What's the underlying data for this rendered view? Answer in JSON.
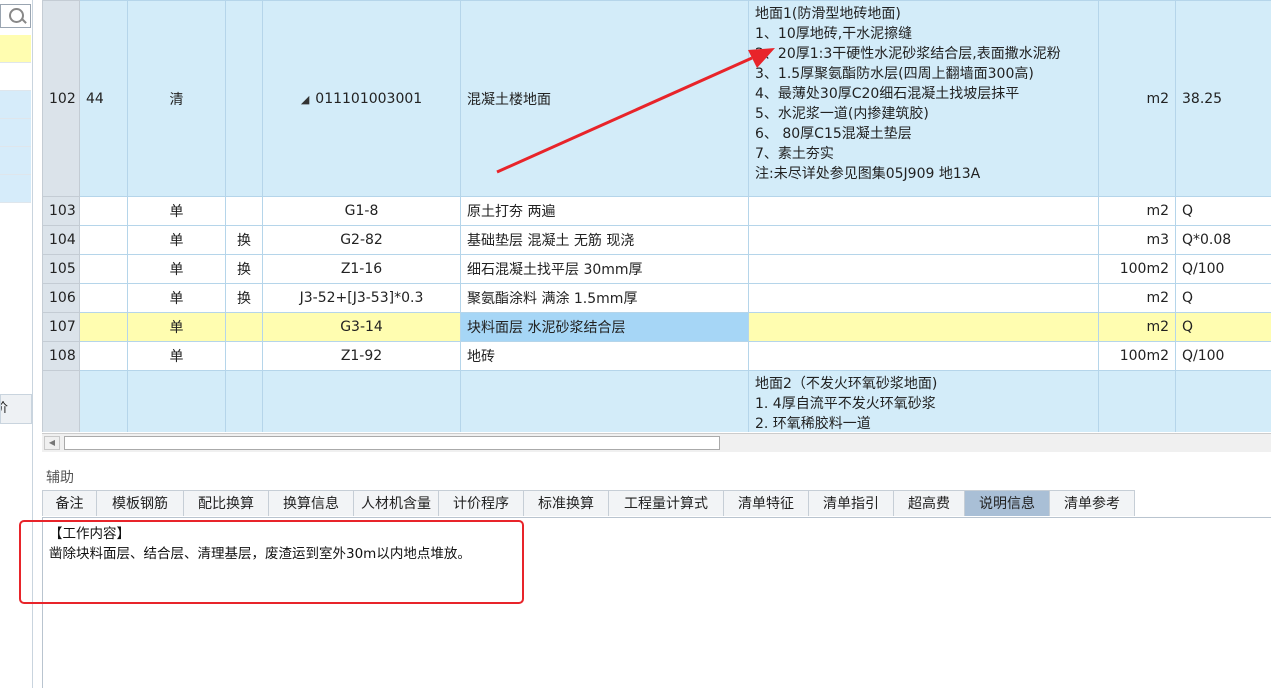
{
  "aux_panel": {
    "title": "辅助"
  },
  "left_panel": {
    "tab_fragment": "价"
  },
  "grid_rows": [
    {
      "no": "102",
      "seq": "44",
      "cat": "清",
      "flag": "",
      "code": "011101003001",
      "name": "混凝土楼地面",
      "feature_lines": [
        "地面1(防滑型地砖地面)",
        "1、10厚地砖,干水泥擦缝",
        "2、20厚1:3干硬性水泥砂浆结合层,表面撒水泥粉",
        "3、1.5厚聚氨酯防水层(四周上翻墙面300高)",
        "4、最薄处30厚C20细石混凝土找坡层抹平",
        "5、水泥浆一道(内掺建筑胶)",
        "6、 80厚C15混凝土垫层",
        "7、素土夯实",
        "注:未尽详处参见图集05J909 地13A"
      ],
      "unit": "m2",
      "qty": "38.25"
    },
    {
      "no": "103",
      "seq": "",
      "cat": "单",
      "flag": "",
      "code": "G1-8",
      "name": "原土打夯 两遍",
      "unit": "m2",
      "qty": "Q"
    },
    {
      "no": "104",
      "seq": "",
      "cat": "单",
      "flag": "换",
      "code": "G2-82",
      "name": "基础垫层 混凝土 无筋 现浇",
      "unit": "m3",
      "qty": "Q*0.08"
    },
    {
      "no": "105",
      "seq": "",
      "cat": "单",
      "flag": "换",
      "code": "Z1-16",
      "name": "细石混凝土找平层 30mm厚",
      "unit": "100m2",
      "qty": "Q/100"
    },
    {
      "no": "106",
      "seq": "",
      "cat": "单",
      "flag": "换",
      "code": "J3-52+[J3-53]*0.3",
      "name": "聚氨酯涂料 满涂 1.5mm厚",
      "unit": "m2",
      "qty": "Q"
    },
    {
      "no": "107",
      "seq": "",
      "cat": "单",
      "flag": "",
      "code": "G3-14",
      "name": "块料面层 水泥砂浆结合层",
      "unit": "m2",
      "qty": "Q"
    },
    {
      "no": "108",
      "seq": "",
      "cat": "单",
      "flag": "",
      "code": "Z1-92",
      "name": "地砖",
      "unit": "100m2",
      "qty": "Q/100"
    },
    {
      "no": "",
      "seq": "",
      "cat": "",
      "flag": "",
      "code": "",
      "name": "",
      "feature_lines": [
        "地面2（不发火环氧砂浆地面)",
        "1. 4厚自流平不发火环氧砂浆",
        "2. 环氧稀胶料一道"
      ],
      "unit": "",
      "qty": ""
    }
  ],
  "tabs": [
    "备注",
    "模板钢筋",
    "配比换算",
    "换算信息",
    "人材机含量",
    "计价程序",
    "标准换算",
    "工程量计算式",
    "清单特征",
    "清单指引",
    "超高费",
    "说明信息",
    "清单参考"
  ],
  "active_tab": "说明信息",
  "description": {
    "heading": "【工作内容】",
    "text": "凿除块料面层、结合层、清理基层，废渣运到室外30m以内地点堆放。"
  },
  "annotation_color": "#e8242a"
}
